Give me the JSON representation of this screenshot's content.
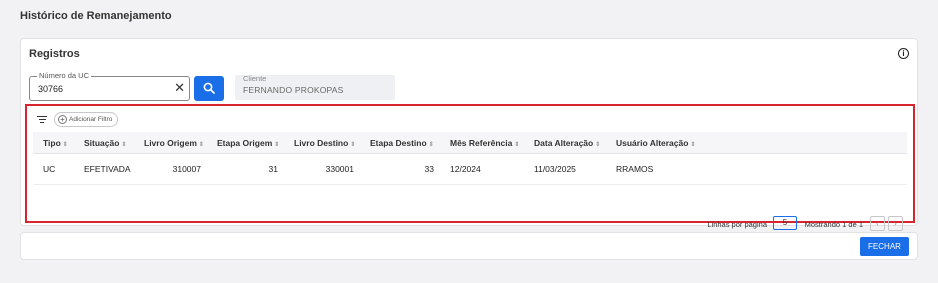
{
  "page": {
    "title": "Histórico de Remanejamento"
  },
  "registros": {
    "title": "Registros",
    "info_icon": "info-circle-icon",
    "uc_field": {
      "label": "Número da UC",
      "value": "30766"
    },
    "search_icon": "search-icon",
    "cliente_field": {
      "label": "Cliente",
      "value": "FERNANDO PROKOPAS"
    }
  },
  "filter": {
    "icon": "filter-lines-icon",
    "add_label": "Adicionar Filtro",
    "add_icon": "plus-circle-icon"
  },
  "table": {
    "sort_glyph": "⇕",
    "headers": [
      "Tipo",
      "Situação",
      "Livro Origem",
      "Etapa Origem",
      "Livro Destino",
      "Etapa Destino",
      "Mês Referência",
      "Data Alteração",
      "Usuário Alteração"
    ],
    "rows": [
      [
        "UC",
        "EFETIVADA",
        "310007",
        "31",
        "330001",
        "33",
        "12/2024",
        "11/03/2025",
        "RRAMOS"
      ]
    ]
  },
  "pagination": {
    "rows_per_page_label": "Linhas por página",
    "rows_per_page": "5",
    "range_text": "Mostrando 1 de 1",
    "prev_glyph": "‹",
    "next_glyph": "›"
  },
  "footer": {
    "close_label": "FECHAR"
  },
  "colors": {
    "accent": "#1a6ee8",
    "highlight": "#d9232e"
  }
}
